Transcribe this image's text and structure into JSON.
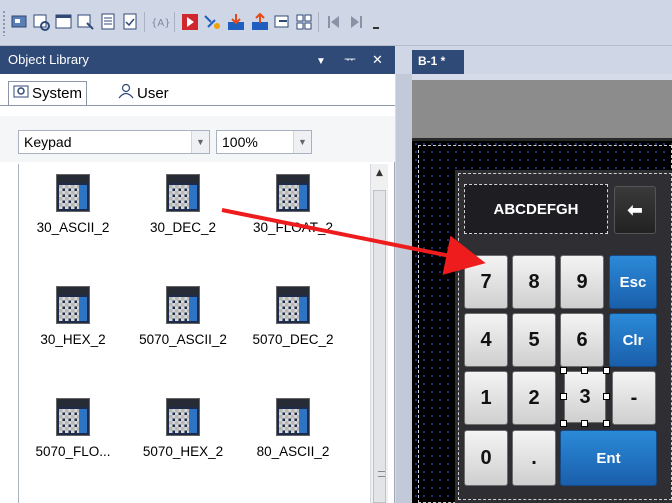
{
  "toolbar": {
    "icons": [
      "screen-icon",
      "object-icon",
      "window-icon",
      "find-icon",
      "list-icon",
      "check-icon",
      "text-tag-icon",
      "run-icon",
      "settings-icon",
      "download-icon",
      "upload-icon",
      "hand-icon",
      "grid-icon",
      "first-icon",
      "last-icon"
    ],
    "colors": {
      "accent": "#2f4a77",
      "run": "#d0262e",
      "download": "#1f5fbf",
      "upload": "#e64a19"
    }
  },
  "object_library": {
    "title": "Object Library",
    "pin_glyph": "▼",
    "dock_glyph": "ᅲ",
    "close_glyph": "✕",
    "tabs": [
      {
        "label": "System",
        "active": true
      },
      {
        "label": "User",
        "active": false
      }
    ],
    "category": "Keypad",
    "zoom": "100%",
    "items": [
      {
        "label": "30_ASCII_2"
      },
      {
        "label": "30_DEC_2"
      },
      {
        "label": "30_FLOAT_2"
      },
      {
        "label": "30_HEX_2"
      },
      {
        "label": "5070_ASCII_2"
      },
      {
        "label": "5070_DEC_2"
      },
      {
        "label": "5070_FLO..."
      },
      {
        "label": "5070_HEX_2"
      },
      {
        "label": "80_ASCII_2"
      }
    ]
  },
  "editor": {
    "tab_label": "B-1 *",
    "keypad": {
      "display_text": "ABCDEFGH",
      "keys": [
        "7",
        "8",
        "9",
        "Esc",
        "4",
        "5",
        "6",
        "Clr",
        "1",
        "2",
        "3",
        "-",
        "0",
        ".",
        "Ent"
      ],
      "backspace_glyph": "⬅"
    }
  }
}
